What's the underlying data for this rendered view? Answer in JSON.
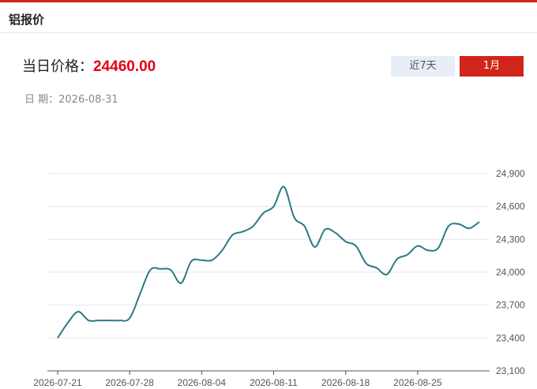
{
  "header": {
    "title": "铝报价"
  },
  "price": {
    "label": "当日价格：",
    "value": "24460.00"
  },
  "date": {
    "label": "日 期：",
    "value": "2026-08-31"
  },
  "tabs": [
    {
      "label": "近7天",
      "active": false
    },
    {
      "label": "1月",
      "active": true
    }
  ],
  "colors": {
    "accent": "#d1251b",
    "price": "#e60012",
    "line": "#2b7a83",
    "grid": "#e3e6ee"
  },
  "chart_data": {
    "type": "line",
    "title": "",
    "xlabel": "",
    "ylabel": "",
    "x_ticks": [
      "2026-07-21",
      "2026-07-28",
      "2026-08-04",
      "2026-08-11",
      "2026-08-18",
      "2026-08-25"
    ],
    "y_ticks": [
      "24,900",
      "24,600",
      "24,300",
      "24,000",
      "23,700",
      "23,400",
      "23,100"
    ],
    "ylim": [
      23100,
      24900
    ],
    "grid": true,
    "series": [
      {
        "values": [
          [
            "2026-07-21",
            23400
          ],
          [
            "2026-07-22",
            23540
          ],
          [
            "2026-07-23",
            23640
          ],
          [
            "2026-07-24",
            23560
          ],
          [
            "2026-07-25",
            23560
          ],
          [
            "2026-07-26",
            23560
          ],
          [
            "2026-07-27",
            23560
          ],
          [
            "2026-07-28",
            23580
          ],
          [
            "2026-07-29",
            23800
          ],
          [
            "2026-07-30",
            24020
          ],
          [
            "2026-07-31",
            24030
          ],
          [
            "2026-08-01",
            24020
          ],
          [
            "2026-08-02",
            23900
          ],
          [
            "2026-08-03",
            24100
          ],
          [
            "2026-08-04",
            24110
          ],
          [
            "2026-08-05",
            24110
          ],
          [
            "2026-08-06",
            24200
          ],
          [
            "2026-08-07",
            24340
          ],
          [
            "2026-08-08",
            24370
          ],
          [
            "2026-08-09",
            24420
          ],
          [
            "2026-08-10",
            24540
          ],
          [
            "2026-08-11",
            24600
          ],
          [
            "2026-08-12",
            24780
          ],
          [
            "2026-08-13",
            24500
          ],
          [
            "2026-08-14",
            24420
          ],
          [
            "2026-08-15",
            24230
          ],
          [
            "2026-08-16",
            24390
          ],
          [
            "2026-08-17",
            24360
          ],
          [
            "2026-08-18",
            24280
          ],
          [
            "2026-08-19",
            24240
          ],
          [
            "2026-08-20",
            24080
          ],
          [
            "2026-08-21",
            24040
          ],
          [
            "2026-08-22",
            23980
          ],
          [
            "2026-08-23",
            24120
          ],
          [
            "2026-08-24",
            24160
          ],
          [
            "2026-08-25",
            24240
          ],
          [
            "2026-08-26",
            24200
          ],
          [
            "2026-08-27",
            24220
          ],
          [
            "2026-08-28",
            24420
          ],
          [
            "2026-08-29",
            24440
          ],
          [
            "2026-08-30",
            24400
          ],
          [
            "2026-08-31",
            24460
          ]
        ]
      }
    ]
  }
}
